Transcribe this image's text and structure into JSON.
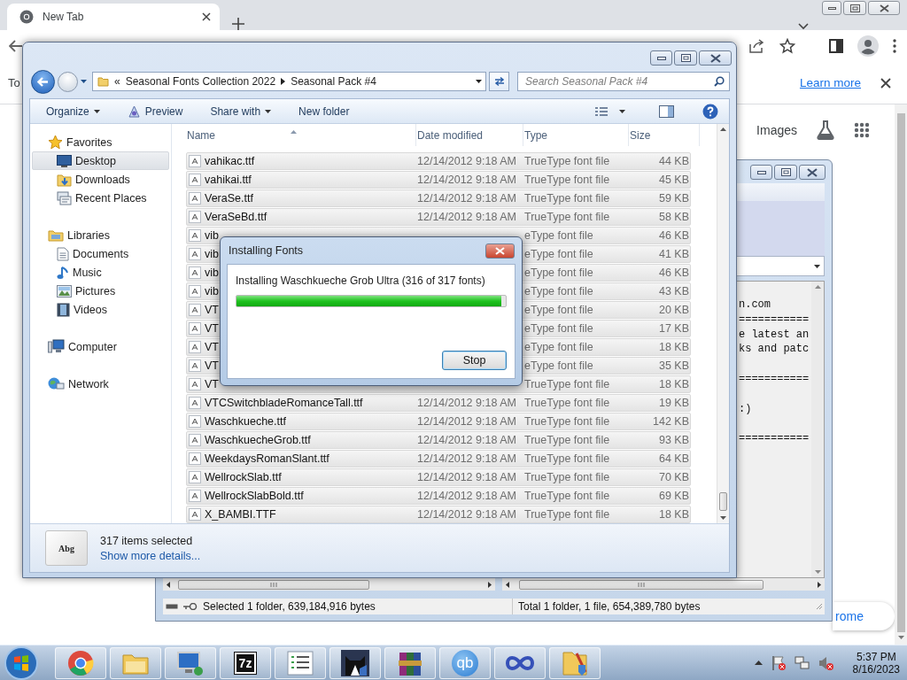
{
  "browser": {
    "tab_title": "New Tab",
    "infobar": {
      "text": "To",
      "link": "Learn more"
    },
    "page": {
      "link": "Images",
      "promo_text": "rome"
    }
  },
  "back_window": {
    "text_blocks": [
      [
        "n.com",
        "===========",
        "e latest an",
        "ks and patc"
      ],
      [
        "==========="
      ],
      [
        ":)"
      ],
      [
        "==========="
      ]
    ],
    "status": [
      "Selected 1 folder, 639,184,916 bytes",
      "Total 1 folder, 1 file, 654,389,780 bytes"
    ]
  },
  "explorer": {
    "breadcrumb": {
      "overflow": "«",
      "items": [
        "Seasonal Fonts Collection 2022",
        "Seasonal Pack #4"
      ]
    },
    "search": {
      "placeholder": "Search Seasonal Pack #4"
    },
    "toolbar": [
      {
        "label": "Organize",
        "kind": "menu"
      },
      {
        "label": "Preview",
        "kind": "preview"
      },
      {
        "label": "Share with",
        "kind": "menu"
      },
      {
        "label": "New folder",
        "kind": "plain"
      }
    ],
    "nav": [
      {
        "label": "Favorites",
        "kind": "star",
        "selected": false,
        "children": [
          {
            "label": "Desktop",
            "kind": "desktop",
            "selected": true
          },
          {
            "label": "Downloads",
            "kind": "downloads",
            "selected": false
          },
          {
            "label": "Recent Places",
            "kind": "recent",
            "selected": false
          }
        ]
      },
      {
        "label": "Libraries",
        "kind": "libraries",
        "selected": false,
        "children": [
          {
            "label": "Documents",
            "kind": "documents",
            "selected": false
          },
          {
            "label": "Music",
            "kind": "music",
            "selected": false
          },
          {
            "label": "Pictures",
            "kind": "pictures",
            "selected": false
          },
          {
            "label": "Videos",
            "kind": "videos",
            "selected": false
          }
        ]
      },
      {
        "label": "Computer",
        "kind": "computer",
        "selected": false
      },
      {
        "label": "Network",
        "kind": "network",
        "selected": false
      }
    ],
    "columns": [
      {
        "label": "Name",
        "sorted": true
      },
      {
        "label": "Date modified",
        "sorted": false
      },
      {
        "label": "Type",
        "sorted": false
      },
      {
        "label": "Size",
        "sorted": false
      }
    ],
    "rows": [
      {
        "name": "vahikac.ttf",
        "date": "12/14/2012 9:18 AM",
        "type": "TrueType font file",
        "size": "44 KB",
        "selected": true
      },
      {
        "name": "vahikai.ttf",
        "date": "12/14/2012 9:18 AM",
        "type": "TrueType font file",
        "size": "45 KB",
        "selected": true
      },
      {
        "name": "VeraSe.ttf",
        "date": "12/14/2012 9:18 AM",
        "type": "TrueType font file",
        "size": "59 KB",
        "selected": true
      },
      {
        "name": "VeraSeBd.ttf",
        "date": "12/14/2012 9:18 AM",
        "type": "TrueType font file",
        "size": "58 KB",
        "selected": true
      },
      {
        "name": "vib",
        "type": "eType font file",
        "size": "46 KB",
        "selected": true
      },
      {
        "name": "vib",
        "type": "eType font file",
        "size": "41 KB",
        "selected": true
      },
      {
        "name": "vib",
        "type": "eType font file",
        "size": "46 KB",
        "selected": true
      },
      {
        "name": "vib",
        "type": "eType font file",
        "size": "43 KB",
        "selected": true
      },
      {
        "name": "VT",
        "type": "eType font file",
        "size": "20 KB",
        "selected": true
      },
      {
        "name": "VT",
        "type": "eType font file",
        "size": "17 KB",
        "selected": true
      },
      {
        "name": "VT",
        "type": "eType font file",
        "size": "18 KB",
        "selected": true
      },
      {
        "name": "VT",
        "type": "eType font file",
        "size": "35 KB",
        "selected": true
      },
      {
        "name": "VT",
        "type": "TrueType font file",
        "size": "18 KB",
        "selected": true
      },
      {
        "name": "VTCSwitchbladeRomanceTall.ttf",
        "date": "12/14/2012 9:18 AM",
        "type": "TrueType font file",
        "size": "19 KB",
        "selected": true
      },
      {
        "name": "Waschkueche.ttf",
        "date": "12/14/2012 9:18 AM",
        "type": "TrueType font file",
        "size": "142 KB",
        "selected": true
      },
      {
        "name": "WaschkuecheGrob.ttf",
        "date": "12/14/2012 9:18 AM",
        "type": "TrueType font file",
        "size": "93 KB",
        "selected": true
      },
      {
        "name": "WeekdaysRomanSlant.ttf",
        "date": "12/14/2012 9:18 AM",
        "type": "TrueType font file",
        "size": "64 KB",
        "selected": true
      },
      {
        "name": "WellrockSlab.ttf",
        "date": "12/14/2012 9:18 AM",
        "type": "TrueType font file",
        "size": "70 KB",
        "selected": true
      },
      {
        "name": "WellrockSlabBold.ttf",
        "date": "12/14/2012 9:18 AM",
        "type": "TrueType font file",
        "size": "69 KB",
        "selected": true
      },
      {
        "name": "X_BAMBI.TTF",
        "date": "12/14/2012 9:18 AM",
        "type": "TrueType font file",
        "size": "18 KB",
        "selected": true
      }
    ],
    "details": {
      "thumb": "Abg",
      "count": "317 items selected",
      "link": "Show more details..."
    }
  },
  "dialog": {
    "title": "Installing Fonts",
    "message": "Installing Waschkueche Grob Ultra (316 of 317 fonts)",
    "progress": {
      "level": 0.985
    },
    "button": "Stop"
  },
  "taskbar": {
    "apps": [
      {
        "kind": "chrome"
      },
      {
        "kind": "explorer"
      },
      {
        "kind": "remote"
      },
      {
        "kind": "sevenzip",
        "label": "7z"
      },
      {
        "kind": "list"
      },
      {
        "kind": "cat"
      },
      {
        "kind": "winrar"
      },
      {
        "kind": "qbittorrent",
        "label": "qb"
      },
      {
        "kind": "infinity"
      },
      {
        "kind": "shieldfolder"
      }
    ],
    "clock": {
      "time": "5:37 PM",
      "date": "8/16/2023"
    }
  }
}
